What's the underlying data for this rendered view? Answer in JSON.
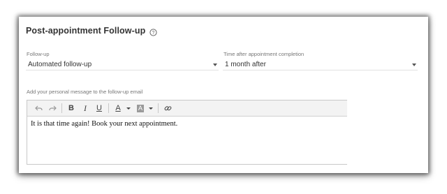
{
  "section": {
    "title": "Post-appointment Follow-up",
    "help_icon": "question-circle-icon"
  },
  "followup": {
    "label": "Follow-up",
    "value": "Automated follow-up"
  },
  "time_after": {
    "label": "Time after appointment completion",
    "value": "1 month after"
  },
  "message": {
    "label": "Add your personal message to the follow-up email",
    "body": "It is that time again!  Book your next appointment."
  },
  "toolbar": {
    "undo_icon": "undo-icon",
    "redo_icon": "redo-icon",
    "bold": "B",
    "italic": "I",
    "underline": "U",
    "text_color": "A",
    "bg_color": "A",
    "link_icon": "link-icon"
  }
}
